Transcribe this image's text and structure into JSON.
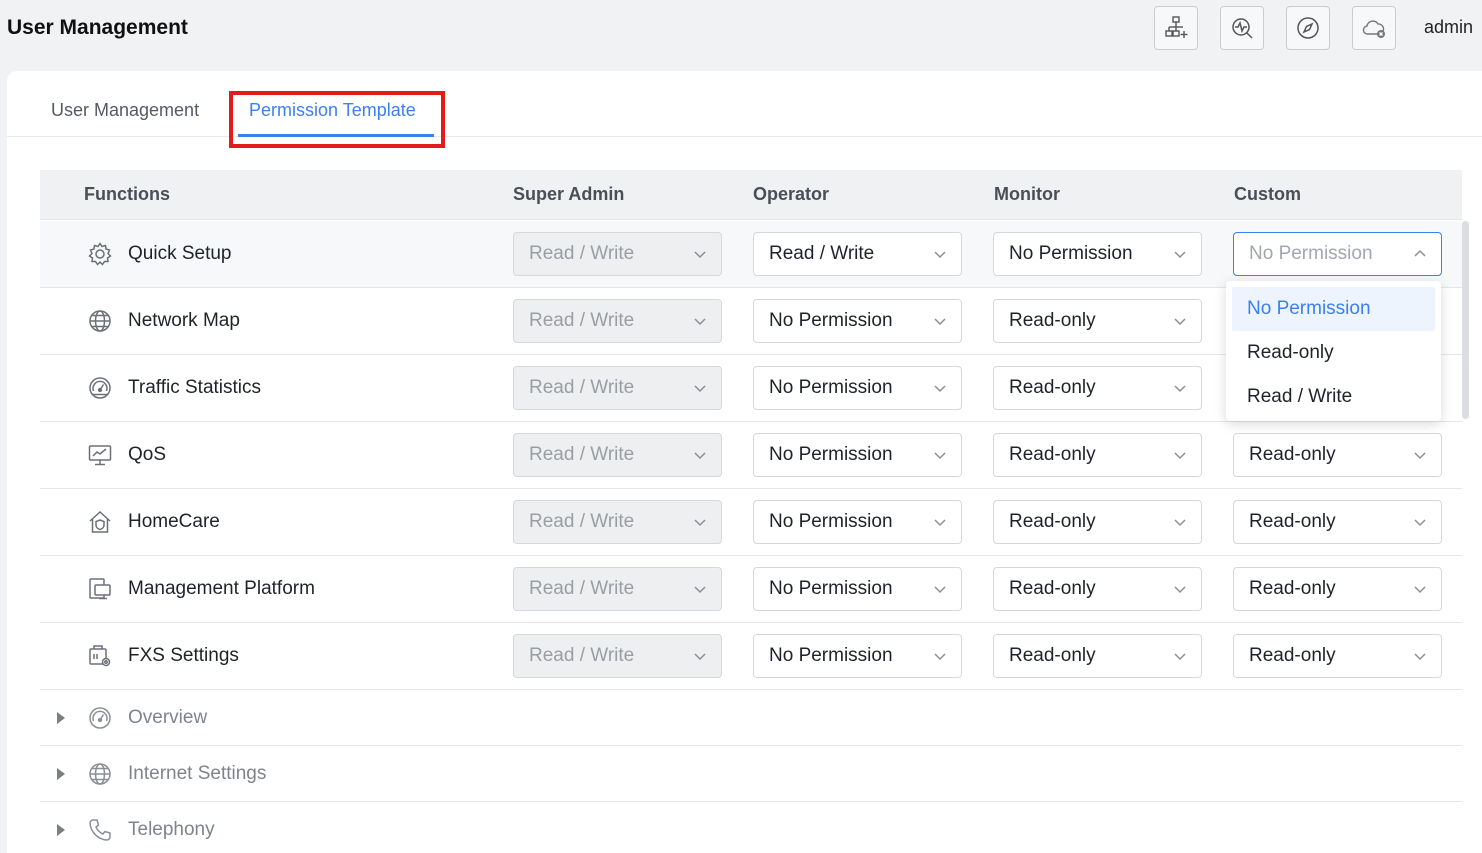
{
  "app": {
    "title": "User Management",
    "user": "admin"
  },
  "header_icons": [
    "topology-icon",
    "diagnostics-icon",
    "compass-icon",
    "cloud-disconnected-icon"
  ],
  "tabs": {
    "user_management": "User Management",
    "permission_template": "Permission Template",
    "active": "Permission Template"
  },
  "table": {
    "headers": {
      "functions": "Functions",
      "super_admin": "Super Admin",
      "operator": "Operator",
      "monitor": "Monitor",
      "custom": "Custom"
    },
    "rows": [
      {
        "label": "Quick Setup",
        "icon": "gear-icon",
        "super_admin": "Read / Write",
        "operator": "Read / Write",
        "monitor": "No Permission",
        "custom": "No Permission"
      },
      {
        "label": "Network Map",
        "icon": "globe-icon",
        "super_admin": "Read / Write",
        "operator": "No Permission",
        "monitor": "Read-only",
        "custom": ""
      },
      {
        "label": "Traffic Statistics",
        "icon": "gauge-icon",
        "super_admin": "Read / Write",
        "operator": "No Permission",
        "monitor": "Read-only",
        "custom": ""
      },
      {
        "label": "QoS",
        "icon": "monitor-chart-icon",
        "super_admin": "Read / Write",
        "operator": "No Permission",
        "monitor": "Read-only",
        "custom": "Read-only"
      },
      {
        "label": "HomeCare",
        "icon": "home-shield-icon",
        "super_admin": "Read / Write",
        "operator": "No Permission",
        "monitor": "Read-only",
        "custom": "Read-only"
      },
      {
        "label": "Management Platform",
        "icon": "platform-icon",
        "super_admin": "Read / Write",
        "operator": "No Permission",
        "monitor": "Read-only",
        "custom": "Read-only"
      },
      {
        "label": "FXS Settings",
        "icon": "fxs-settings-icon",
        "super_admin": "Read / Write",
        "operator": "No Permission",
        "monitor": "Read-only",
        "custom": "Read-only"
      }
    ],
    "groups": [
      {
        "label": "Overview",
        "icon": "gauge-icon"
      },
      {
        "label": "Internet Settings",
        "icon": "globe-icon"
      },
      {
        "label": "Telephony",
        "icon": "phone-icon"
      }
    ]
  },
  "dropdown": {
    "options": [
      "No Permission",
      "Read-only",
      "Read / Write"
    ],
    "selected": "No Permission"
  },
  "colors": {
    "accent": "#3c7ff0",
    "highlight": "#e31b1b"
  }
}
